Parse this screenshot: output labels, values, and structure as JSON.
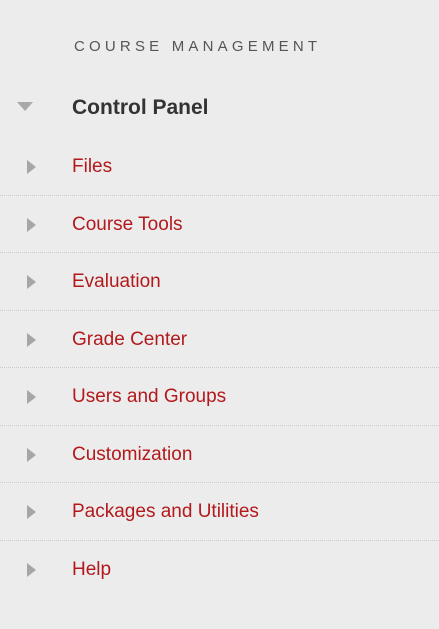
{
  "section": {
    "heading": "COURSE MANAGEMENT"
  },
  "control_panel": {
    "label": "Control Panel",
    "icon": "triangle-down-icon"
  },
  "nav": {
    "items": [
      {
        "label": "Files",
        "icon": "triangle-right-icon"
      },
      {
        "label": "Course Tools",
        "icon": "triangle-right-icon"
      },
      {
        "label": "Evaluation",
        "icon": "triangle-right-icon"
      },
      {
        "label": "Grade Center",
        "icon": "triangle-right-icon"
      },
      {
        "label": "Users and Groups",
        "icon": "triangle-right-icon"
      },
      {
        "label": "Customization",
        "icon": "triangle-right-icon"
      },
      {
        "label": "Packages and Utilities",
        "icon": "triangle-right-icon"
      },
      {
        "label": "Help",
        "icon": "triangle-right-icon"
      }
    ]
  },
  "colors": {
    "panel_background": "#ececec",
    "link": "#b3191c",
    "heading_text": "#555555",
    "control_panel_text": "#333333",
    "triangle": "#a6a6a6"
  }
}
